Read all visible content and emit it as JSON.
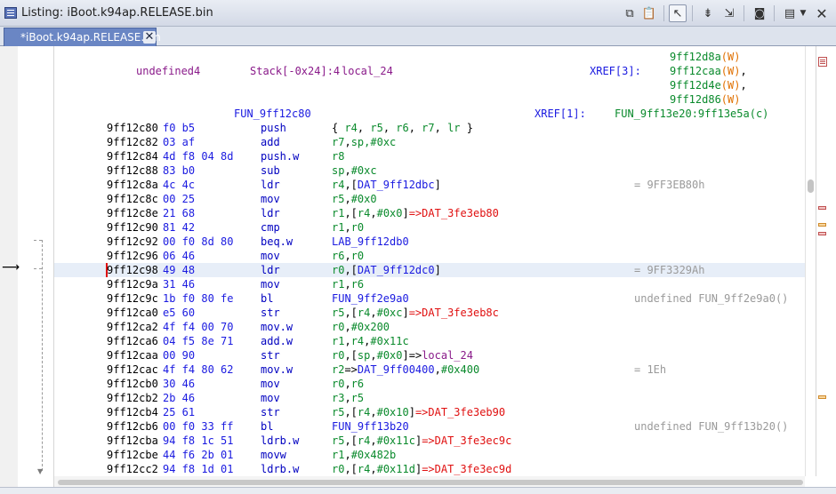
{
  "window": {
    "title": "Listing:  iBoot.k94ap.RELEASE.bin",
    "tab_label": "*iBoot.k94ap.RELEASE.bin"
  },
  "function_header": {
    "var_type": "undefined4",
    "var_location": "Stack[-0x24]:4",
    "var_name": "local_24",
    "var_xref_label": "XREF[3]:",
    "var_xrefs": [
      {
        "addr": "9ff12d8a",
        "kind": "(W)",
        "sep": ""
      },
      {
        "addr": "9ff12caa",
        "kind": "(W)",
        "sep": ","
      },
      {
        "addr": "9ff12d4e",
        "kind": "(W)",
        "sep": ","
      },
      {
        "addr": "9ff12d86",
        "kind": "(W)",
        "sep": ""
      }
    ],
    "func_name": "FUN_9ff12c80",
    "func_xref_label": "XREF[1]:",
    "func_xref": "FUN_9ff13e20:9ff13e5a(c)"
  },
  "rows": [
    {
      "addr": "9ff12c80",
      "bytes": "f0 b5",
      "mnemonic": "push",
      "operands": [
        {
          "t": "{ "
        },
        {
          "t": "r4",
          "c": "grn"
        },
        {
          "t": ", "
        },
        {
          "t": "r5",
          "c": "grn"
        },
        {
          "t": ", "
        },
        {
          "t": "r6",
          "c": "grn"
        },
        {
          "t": ", "
        },
        {
          "t": "r7",
          "c": "grn"
        },
        {
          "t": ", "
        },
        {
          "t": "lr",
          "c": "grn"
        },
        {
          "t": " }"
        }
      ],
      "comment": ""
    },
    {
      "addr": "9ff12c82",
      "bytes": "03 af",
      "mnemonic": "add",
      "operands": [
        {
          "t": "r7",
          "c": "grn"
        },
        {
          "t": ","
        },
        {
          "t": "sp",
          "c": "grn"
        },
        {
          "t": ",#0xc",
          "c": "grn"
        }
      ],
      "comment": ""
    },
    {
      "addr": "9ff12c84",
      "bytes": "4d f8 04 8d",
      "mnemonic": "push.w",
      "operands": [
        {
          "t": "r8",
          "c": "grn"
        }
      ],
      "comment": ""
    },
    {
      "addr": "9ff12c88",
      "bytes": "83 b0",
      "mnemonic": "sub",
      "operands": [
        {
          "t": "sp",
          "c": "grn"
        },
        {
          "t": ","
        },
        {
          "t": "#0xc",
          "c": "grn"
        }
      ],
      "comment": ""
    },
    {
      "addr": "9ff12c8a",
      "bytes": "4c 4c",
      "mnemonic": "ldr",
      "operands": [
        {
          "t": "r4",
          "c": "grn"
        },
        {
          "t": ",["
        },
        {
          "t": "DAT_9ff12dbc",
          "c": "blu"
        },
        {
          "t": "]"
        }
      ],
      "comment": "= 9FF3EB80h"
    },
    {
      "addr": "9ff12c8c",
      "bytes": "00 25",
      "mnemonic": "mov",
      "operands": [
        {
          "t": "r5",
          "c": "grn"
        },
        {
          "t": ","
        },
        {
          "t": "#0x0",
          "c": "grn"
        }
      ],
      "comment": ""
    },
    {
      "addr": "9ff12c8e",
      "bytes": "21 68",
      "mnemonic": "ldr",
      "operands": [
        {
          "t": "r1",
          "c": "grn"
        },
        {
          "t": ",["
        },
        {
          "t": "r4",
          "c": "grn"
        },
        {
          "t": ","
        },
        {
          "t": "#0x0",
          "c": "grn"
        },
        {
          "t": "]"
        },
        {
          "t": "=>DAT_3fe3eb80",
          "c": "red"
        }
      ],
      "comment": ""
    },
    {
      "addr": "9ff12c90",
      "bytes": "81 42",
      "mnemonic": "cmp",
      "operands": [
        {
          "t": "r1",
          "c": "grn"
        },
        {
          "t": ","
        },
        {
          "t": "r0",
          "c": "grn"
        }
      ],
      "comment": ""
    },
    {
      "addr": "9ff12c92",
      "bytes": "00 f0 8d 80",
      "mnemonic": "beq.w",
      "operands": [
        {
          "t": "LAB_9ff12db0",
          "c": "blu"
        }
      ],
      "comment": ""
    },
    {
      "addr": "9ff12c96",
      "bytes": "06 46",
      "mnemonic": "mov",
      "operands": [
        {
          "t": "r6",
          "c": "grn"
        },
        {
          "t": ","
        },
        {
          "t": "r0",
          "c": "grn"
        }
      ],
      "comment": ""
    },
    {
      "addr": "9ff12c98",
      "bytes": "49 48",
      "mnemonic": "ldr",
      "operands": [
        {
          "t": "r0",
          "c": "grn"
        },
        {
          "t": ",["
        },
        {
          "t": "DAT_9ff12dc0",
          "c": "blu"
        },
        {
          "t": "]"
        }
      ],
      "comment": "= 9FF3329Ah",
      "highlight": true
    },
    {
      "addr": "9ff12c9a",
      "bytes": "31 46",
      "mnemonic": "mov",
      "operands": [
        {
          "t": "r1",
          "c": "grn"
        },
        {
          "t": ","
        },
        {
          "t": "r6",
          "c": "grn"
        }
      ],
      "comment": ""
    },
    {
      "addr": "9ff12c9c",
      "bytes": "1b f0 80 fe",
      "mnemonic": "bl",
      "operands": [
        {
          "t": "FUN_9ff2e9a0",
          "c": "blu"
        }
      ],
      "comment": "undefined FUN_9ff2e9a0()"
    },
    {
      "addr": "9ff12ca0",
      "bytes": "e5 60",
      "mnemonic": "str",
      "operands": [
        {
          "t": "r5",
          "c": "grn"
        },
        {
          "t": ",["
        },
        {
          "t": "r4",
          "c": "grn"
        },
        {
          "t": ","
        },
        {
          "t": "#0xc",
          "c": "grn"
        },
        {
          "t": "]"
        },
        {
          "t": "=>DAT_3fe3eb8c",
          "c": "red"
        }
      ],
      "comment": ""
    },
    {
      "addr": "9ff12ca2",
      "bytes": "4f f4 00 70",
      "mnemonic": "mov.w",
      "operands": [
        {
          "t": "r0",
          "c": "grn"
        },
        {
          "t": ","
        },
        {
          "t": "#0x200",
          "c": "grn"
        }
      ],
      "comment": ""
    },
    {
      "addr": "9ff12ca6",
      "bytes": "04 f5 8e 71",
      "mnemonic": "add.w",
      "operands": [
        {
          "t": "r1",
          "c": "grn"
        },
        {
          "t": ","
        },
        {
          "t": "r4",
          "c": "grn"
        },
        {
          "t": ","
        },
        {
          "t": "#0x11c",
          "c": "grn"
        }
      ],
      "comment": ""
    },
    {
      "addr": "9ff12caa",
      "bytes": "00 90",
      "mnemonic": "str",
      "operands": [
        {
          "t": "r0",
          "c": "grn"
        },
        {
          "t": ",["
        },
        {
          "t": "sp",
          "c": "grn"
        },
        {
          "t": ","
        },
        {
          "t": "#0x0",
          "c": "grn"
        },
        {
          "t": "]=>"
        },
        {
          "t": "local_24",
          "c": "pur"
        }
      ],
      "comment": ""
    },
    {
      "addr": "9ff12cac",
      "bytes": "4f f4 80 62",
      "mnemonic": "mov.w",
      "operands": [
        {
          "t": "r2",
          "c": "grn"
        },
        {
          "t": "=>"
        },
        {
          "t": "DAT_9ff00400",
          "c": "blu"
        },
        {
          "t": ","
        },
        {
          "t": "#0x400",
          "c": "grn"
        }
      ],
      "comment": "= 1Eh"
    },
    {
      "addr": "9ff12cb0",
      "bytes": "30 46",
      "mnemonic": "mov",
      "operands": [
        {
          "t": "r0",
          "c": "grn"
        },
        {
          "t": ","
        },
        {
          "t": "r6",
          "c": "grn"
        }
      ],
      "comment": ""
    },
    {
      "addr": "9ff12cb2",
      "bytes": "2b 46",
      "mnemonic": "mov",
      "operands": [
        {
          "t": "r3",
          "c": "grn"
        },
        {
          "t": ","
        },
        {
          "t": "r5",
          "c": "grn"
        }
      ],
      "comment": ""
    },
    {
      "addr": "9ff12cb4",
      "bytes": "25 61",
      "mnemonic": "str",
      "operands": [
        {
          "t": "r5",
          "c": "grn"
        },
        {
          "t": ",["
        },
        {
          "t": "r4",
          "c": "grn"
        },
        {
          "t": ","
        },
        {
          "t": "#0x10",
          "c": "grn"
        },
        {
          "t": "]"
        },
        {
          "t": "=>DAT_3fe3eb90",
          "c": "red"
        }
      ],
      "comment": ""
    },
    {
      "addr": "9ff12cb6",
      "bytes": "00 f0 33 ff",
      "mnemonic": "bl",
      "operands": [
        {
          "t": "FUN_9ff13b20",
          "c": "blu"
        }
      ],
      "comment": "undefined FUN_9ff13b20()"
    },
    {
      "addr": "9ff12cba",
      "bytes": "94 f8 1c 51",
      "mnemonic": "ldrb.w",
      "operands": [
        {
          "t": "r5",
          "c": "grn"
        },
        {
          "t": ",["
        },
        {
          "t": "r4",
          "c": "grn"
        },
        {
          "t": ","
        },
        {
          "t": "#0x11c",
          "c": "grn"
        },
        {
          "t": "]"
        },
        {
          "t": "=>DAT_3fe3ec9c",
          "c": "red"
        }
      ],
      "comment": ""
    },
    {
      "addr": "9ff12cbe",
      "bytes": "44 f6 2b 01",
      "mnemonic": "movw",
      "operands": [
        {
          "t": "r1",
          "c": "grn"
        },
        {
          "t": ","
        },
        {
          "t": "#0x482b",
          "c": "grn"
        }
      ],
      "comment": ""
    },
    {
      "addr": "9ff12cc2",
      "bytes": "94 f8 1d 01",
      "mnemonic": "ldrb.w",
      "operands": [
        {
          "t": "r0",
          "c": "grn"
        },
        {
          "t": ",["
        },
        {
          "t": "r4",
          "c": "grn"
        },
        {
          "t": ","
        },
        {
          "t": "#0x11d",
          "c": "grn"
        },
        {
          "t": "]"
        },
        {
          "t": "=>DAT_3fe3ec9d",
          "c": "red"
        }
      ],
      "comment": ""
    }
  ],
  "overview_markers": [
    "bookmark",
    "change",
    "change",
    "change",
    "search"
  ],
  "colors": {
    "address": "#000000",
    "bytes": "#1a1ae0",
    "register": "#0a8a2c",
    "data_ref": "#e01010",
    "label_ref": "#1a1ae0",
    "stack_var": "#8a1a8a",
    "xref_kind": "#e07000",
    "comment": "#9a9a9a",
    "cursor_row": "#e7eef8"
  },
  "toolbar_icons": [
    "copy-icon",
    "paste-icon",
    "cursor-select-icon",
    "navigation-down-icon",
    "navigate-graph-icon",
    "snapshot-icon",
    "display-options-icon",
    "menu-dropdown-icon"
  ]
}
